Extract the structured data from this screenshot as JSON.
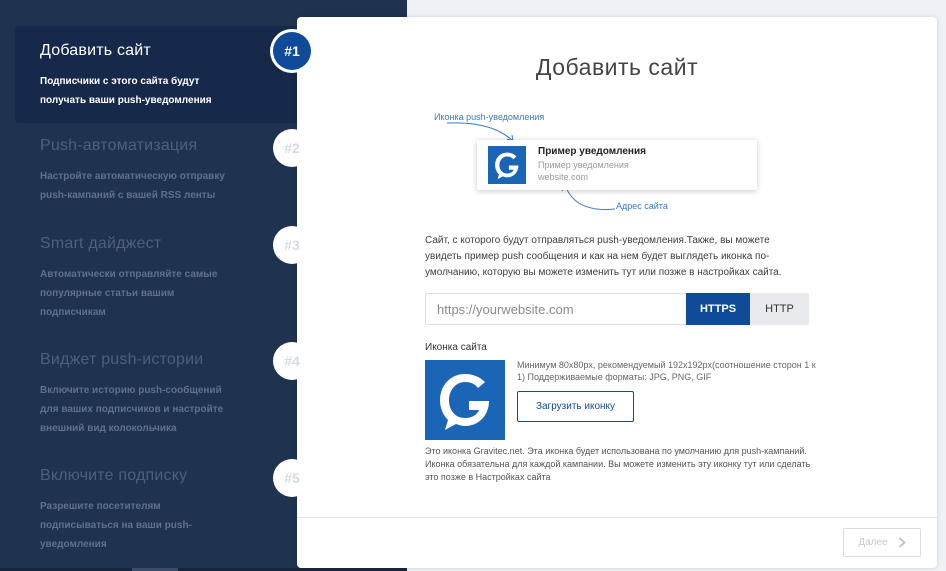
{
  "steps": [
    {
      "badge": "#1",
      "title": "Добавить сайт",
      "desc": "Подписчики с этого сайта будут получать ваши push-уведомления",
      "active": true
    },
    {
      "badge": "#2",
      "title": "Push-автоматизация",
      "desc": "Настройте автоматическую отправку push-кампаний с вашей RSS ленты",
      "active": false
    },
    {
      "badge": "#3",
      "title": "Smart дайджест",
      "desc": "Автоматически отправляйте самые популярные статьи вашим подписчикам",
      "active": false
    },
    {
      "badge": "#4",
      "title": "Виджет push-истории",
      "desc": "Включите историю push-сообщений для ваших подписчиков и настройте внешний вид колокольчика",
      "active": false
    },
    {
      "badge": "#5",
      "title": "Включите подписку",
      "desc": "Разрешите посетителям подписываться на ваши push-уведомления",
      "active": false
    }
  ],
  "main": {
    "title": "Добавить сайт",
    "illustration": {
      "icon_label": "Иконка push-уведомления",
      "address_label": "Адрес сайта",
      "notification": {
        "title": "Пример уведомления",
        "body": "Пример уведомления",
        "site": "website.com",
        "icon": "gravitec-logo"
      }
    },
    "description": "Сайт, с которого будут отправляться push-уведомления.Также, вы можете увидеть пример push сообщения и как на нем будет выглядеть иконка по-умолчанию, которую вы можете изменить тут или позже в настройках сайта.",
    "url_input": {
      "placeholder": "https://yourwebsite.com",
      "value": ""
    },
    "protocol": {
      "options": [
        "HTTPS",
        "HTTP"
      ],
      "selected": "HTTPS"
    },
    "site_icon": {
      "label": "Иконка сайта",
      "hint": "Минимум 80x80px, рекомендуемый 192x192px(соотношение сторон 1 к 1) Поддерживаемые форматы: JPG, PNG, GIF",
      "upload_label": "Загрузить иконку",
      "note": "Это иконка Gravitec.net. Эта иконка будет использована по умолчанию для push-кампаний. Иконка обязательна для каждой кампании. Вы можете изменить эту иконку тут или сделать это позже в Настройках сайта",
      "icon": "gravitec-logo"
    },
    "next_label": "Далее",
    "next_icon": "chevron-right-icon"
  },
  "colors": {
    "sidebar_bg": "#1f3250",
    "active_step_bg": "#17294a",
    "accent": "#0f4b98",
    "logo_bg": "#1a65b5",
    "link_blue": "#3b79c6"
  }
}
